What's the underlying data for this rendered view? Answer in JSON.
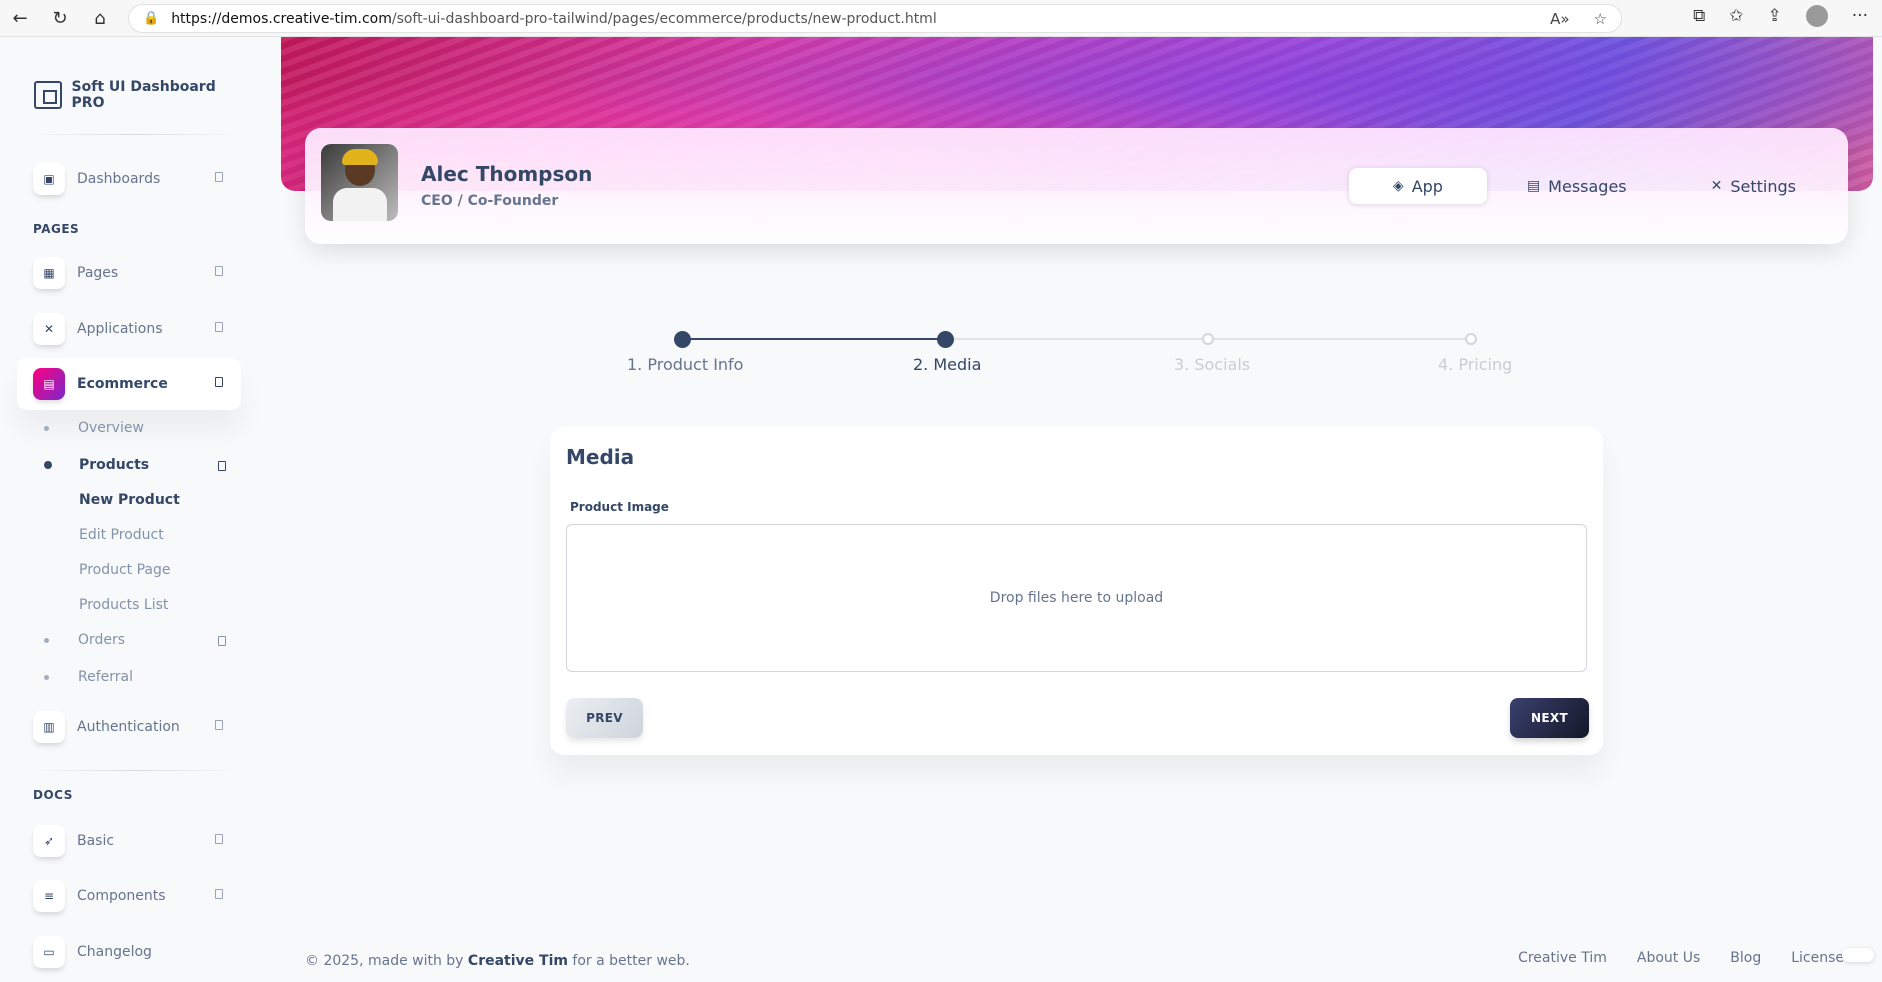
{
  "browser": {
    "url_host": "https://demos.creative-tim.com",
    "url_path": "/soft-ui-dashboard-pro-tailwind/pages/ecommerce/products/new-product.html"
  },
  "sidebar": {
    "brand": "Soft UI Dashboard PRO",
    "dashboards": "Dashboards",
    "section_pages": "PAGES",
    "pages": "Pages",
    "applications": "Applications",
    "ecommerce": "Ecommerce",
    "overview": "Overview",
    "products": "Products",
    "new_product": "New Product",
    "edit_product": "Edit Product",
    "product_page": "Product Page",
    "products_list": "Products List",
    "orders": "Orders",
    "referral": "Referral",
    "authentication": "Authentication",
    "section_docs": "DOCS",
    "basic": "Basic",
    "components": "Components",
    "changelog": "Changelog"
  },
  "profile": {
    "name": "Alec Thompson",
    "role": "CEO / Co-Founder",
    "tabs": [
      "App",
      "Messages",
      "Settings"
    ]
  },
  "stepper": {
    "steps": [
      "1. Product Info",
      "2. Media",
      "3. Socials",
      "4. Pricing"
    ],
    "current_step": 2
  },
  "media_card": {
    "title": "Media",
    "field_label": "Product Image",
    "dropzone_text": "Drop files here to upload",
    "prev": "PREV",
    "next": "NEXT"
  },
  "footer": {
    "copy_prefix": "© 2025, made with by ",
    "copy_brand": "Creative Tim",
    "copy_suffix": " for a better web.",
    "links": [
      "Creative Tim",
      "About Us",
      "Blog",
      "License"
    ]
  },
  "colors": {
    "primary_text": "#344767",
    "accent_gradient_start": "#7928ca",
    "accent_gradient_end": "#ff0080",
    "next_button": "#141727"
  }
}
